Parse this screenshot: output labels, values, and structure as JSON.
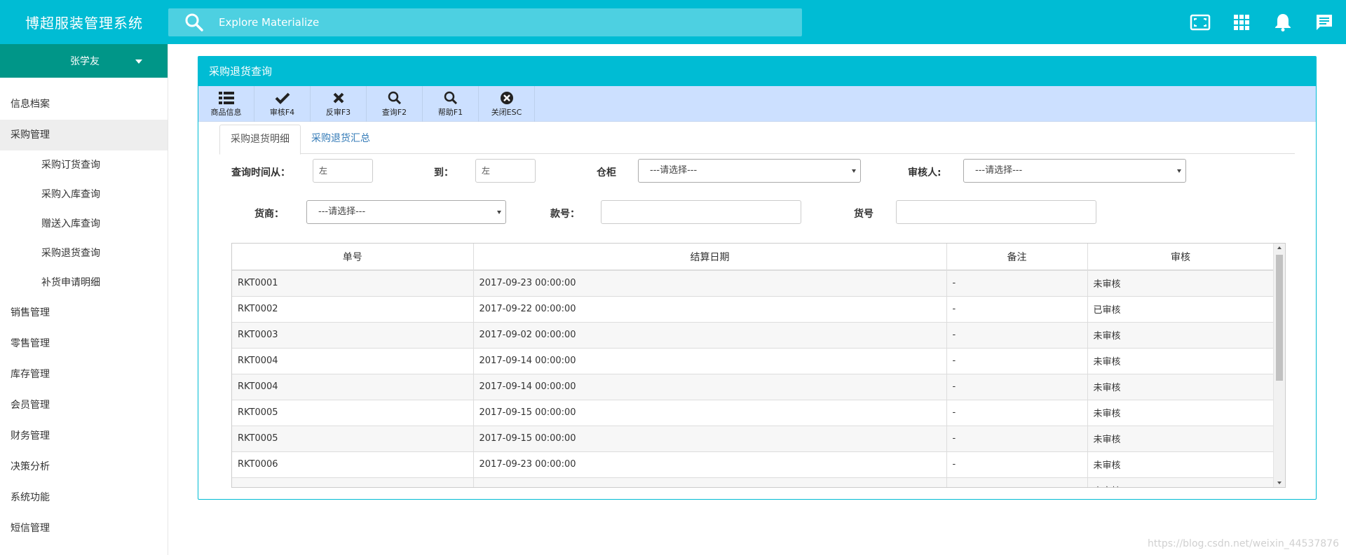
{
  "app": {
    "title": "博超服装管理系统"
  },
  "search": {
    "placeholder": "Explore Materialize"
  },
  "top_icons": [
    "fullscreen-icon",
    "apps-grid-icon",
    "bell-icon",
    "chat-icon"
  ],
  "user": {
    "name": "张学友"
  },
  "sidebar": {
    "items": [
      {
        "label": "信息档案"
      },
      {
        "label": "采购管理",
        "active": true,
        "children": [
          "采购订货查询",
          "采购入库查询",
          "赠送入库查询",
          "采购退货查询",
          "补货申请明细"
        ]
      },
      {
        "label": "销售管理"
      },
      {
        "label": "零售管理"
      },
      {
        "label": "库存管理"
      },
      {
        "label": "会员管理"
      },
      {
        "label": "财务管理"
      },
      {
        "label": "决策分析"
      },
      {
        "label": "系统功能"
      },
      {
        "label": "短信管理"
      }
    ]
  },
  "panel": {
    "title": "采购退货查询"
  },
  "toolbar": {
    "buttons": [
      {
        "label": "商品信息",
        "icon": "list-icon"
      },
      {
        "label": "审核F4",
        "icon": "check-icon"
      },
      {
        "label": "反审F3",
        "icon": "x-icon"
      },
      {
        "label": "查询F2",
        "icon": "search-icon"
      },
      {
        "label": "帮助F1",
        "icon": "search-icon"
      },
      {
        "label": "关闭ESC",
        "icon": "close-circle-icon"
      }
    ]
  },
  "tabs": [
    {
      "label": "采购退货明细",
      "active": true
    },
    {
      "label": "采购退货汇总",
      "active": false
    }
  ],
  "filters": {
    "date_from_label": "查询时间从：",
    "date_from_value": "左",
    "date_to_label": "到：",
    "date_to_value": "左",
    "warehouse_label": "仓柜",
    "warehouse_value": "---请选择---",
    "auditor_label": "审核人:",
    "auditor_value": "---请选择---",
    "supplier_label": "货商：",
    "supplier_value": "---请选择---",
    "style_label": "款号：",
    "style_value": "",
    "item_label": "货号",
    "item_value": ""
  },
  "table": {
    "columns": [
      "单号",
      "结算日期",
      "备注",
      "审核"
    ],
    "rows": [
      [
        "RKT0001",
        "2017-09-23 00:00:00",
        "-",
        "未审核"
      ],
      [
        "RKT0002",
        "2017-09-22 00:00:00",
        "-",
        "已审核"
      ],
      [
        "RKT0003",
        "2017-09-02 00:00:00",
        "-",
        "未审核"
      ],
      [
        "RKT0004",
        "2017-09-14 00:00:00",
        "-",
        "未审核"
      ],
      [
        "RKT0004",
        "2017-09-14 00:00:00",
        "-",
        "未审核"
      ],
      [
        "RKT0005",
        "2017-09-15 00:00:00",
        "-",
        "未审核"
      ],
      [
        "RKT0005",
        "2017-09-15 00:00:00",
        "-",
        "未审核"
      ],
      [
        "RKT0006",
        "2017-09-23 00:00:00",
        "-",
        "未审核"
      ],
      [
        "",
        "",
        "",
        "未审核"
      ]
    ]
  },
  "watermark": "https://blog.csdn.net/weixin_44537876",
  "colors": {
    "primary": "#00bcd4",
    "user_bar": "#009688",
    "toolbar_bg": "#cce0ff"
  }
}
